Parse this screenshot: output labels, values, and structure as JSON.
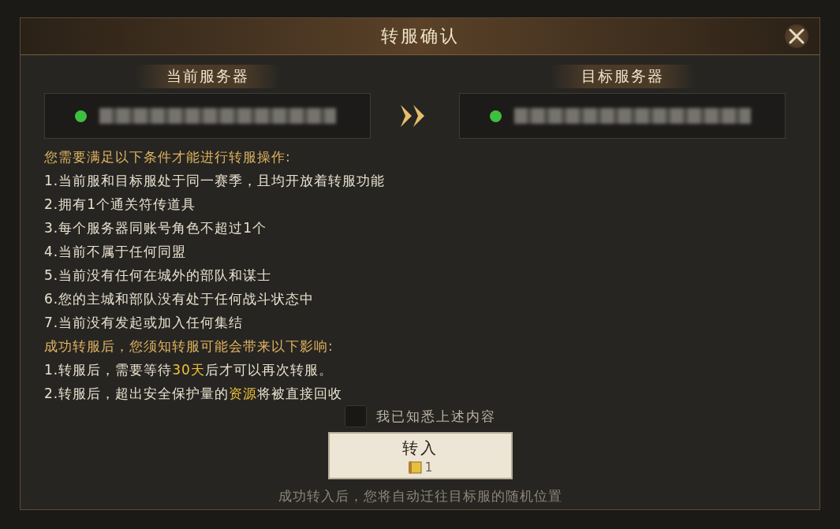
{
  "dialog": {
    "title": "转服确认"
  },
  "current_server": {
    "label": "当前服务器",
    "color": "#3fbf3f"
  },
  "target_server": {
    "label": "目标服务器",
    "color": "#3fbf3f"
  },
  "requirements_heading": "您需要满足以下条件才能进行转服操作:",
  "requirements": [
    [
      {
        "text": "1.当前服和目标服处于同一赛季，且均开放着转服功能",
        "highlight": false
      }
    ],
    [
      {
        "text": "2.拥有1个通关符传道具",
        "highlight": false
      }
    ],
    [
      {
        "text": "3.每个服务器同账号角色不超过1个",
        "highlight": false
      }
    ],
    [
      {
        "text": "4.当前不属于任何同盟",
        "highlight": false
      }
    ],
    [
      {
        "text": "5.当前没有任何在城外的部队和谋士",
        "highlight": false
      }
    ],
    [
      {
        "text": "6.您的主城和部队没有处于任何战斗状态中",
        "highlight": false
      }
    ],
    [
      {
        "text": "7.当前没有发起或加入任何集结",
        "highlight": false
      }
    ]
  ],
  "effects_heading": "成功转服后，您须知转服可能会带来以下影响:",
  "effects": [
    [
      {
        "text": "1.转服后，需要等待",
        "highlight": false
      },
      {
        "text": "30天",
        "highlight": true
      },
      {
        "text": "后才可以再次转服。",
        "highlight": false
      }
    ],
    [
      {
        "text": "2.转服后，超出安全保护量的",
        "highlight": false
      },
      {
        "text": "资源",
        "highlight": true
      },
      {
        "text": "将被直接回收",
        "highlight": false
      }
    ]
  ],
  "acknowledge": {
    "label": "我已知悉上述内容",
    "checked": false
  },
  "transfer_button": {
    "label": "转入",
    "cost": "1"
  },
  "footer_note": "成功转入后，您将自动迁往目标服的随机位置"
}
